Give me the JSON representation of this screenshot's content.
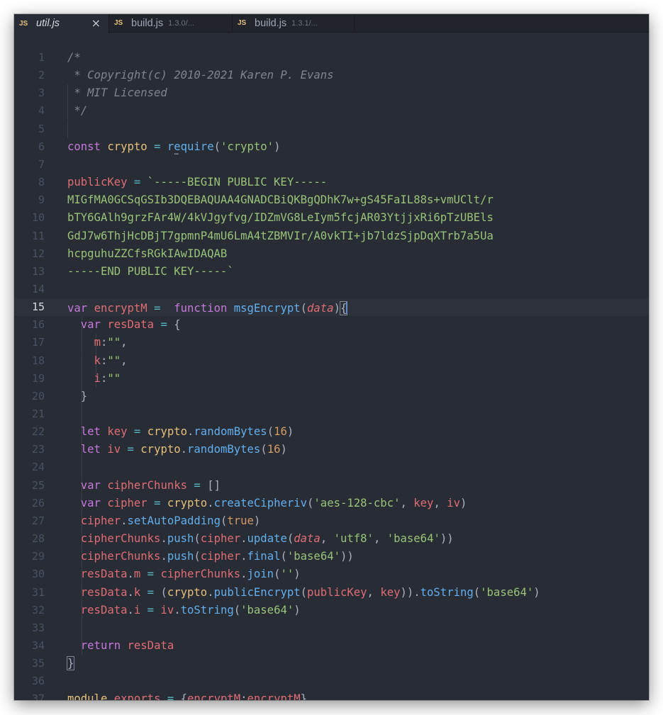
{
  "tabs": [
    {
      "label": "util.js",
      "badge": "JS",
      "path": "",
      "active": true
    },
    {
      "label": "build.js",
      "badge": "JS",
      "path": "1.3.0/...",
      "active": false
    },
    {
      "label": "build.js",
      "badge": "JS",
      "path": "1.3.1/...",
      "active": false
    }
  ],
  "close_icon_glyph": "×",
  "editor": {
    "current_line": 15,
    "line_numbers": [
      "1",
      "2",
      "3",
      "4",
      "5",
      "6",
      "7",
      "8",
      "9",
      "10",
      "11",
      "12",
      "13",
      "14",
      "15",
      "16",
      "17",
      "18",
      "19",
      "20",
      "21",
      "22",
      "23",
      "24",
      "25",
      "26",
      "27",
      "28",
      "29",
      "30",
      "31",
      "32",
      "33",
      "34",
      "35",
      "36",
      "37"
    ],
    "lines": [
      [
        "/*"
      ],
      [
        " * Copyright(c) 2010-2021 Karen P. Evans"
      ],
      [
        " * MIT Licensed"
      ],
      [
        " */"
      ],
      [
        ""
      ],
      [
        "const",
        " ",
        "crypto",
        " ",
        "=",
        " ",
        "require",
        "(",
        "'crypto'",
        ")"
      ],
      [
        ""
      ],
      [
        "publicKey",
        " ",
        "=",
        " ",
        "`-----BEGIN PUBLIC KEY-----"
      ],
      [
        "MIGfMA0GCSqGSIb3DQEBAQUAA4GNADCBiQKBgQDhK7w+gS45FaIL88s+vmUClt/r"
      ],
      [
        "bTY6GAlh9grzFAr4W/4kVJgyfvg/IDZmVG8LeIym5fcjAR03YtjjxRi6pTzUBEls"
      ],
      [
        "GdJ7w6ThjHcDBjT7gpmnP4mU6LmA4tZBMVIr/A0vkTI+jb7ldzSjpDqXTrb7a5Ua"
      ],
      [
        "hcpguhuZZCfsRGkIAwIDAQAB"
      ],
      [
        "-----END PUBLIC KEY-----`"
      ],
      [
        ""
      ],
      [
        "var",
        " ",
        "encryptM",
        " ",
        "=",
        "  ",
        "function",
        " ",
        "msgEncrypt",
        "(",
        "data",
        ")",
        "{"
      ],
      [
        "  ",
        "var",
        " ",
        "resData",
        " ",
        "=",
        " ",
        "{"
      ],
      [
        "    ",
        "m",
        ":",
        "\"\"",
        ","
      ],
      [
        "    ",
        "k",
        ":",
        "\"\"",
        ","
      ],
      [
        "    ",
        "i",
        ":",
        "\"\""
      ],
      [
        "  ",
        "}"
      ],
      [
        ""
      ],
      [
        "  ",
        "let",
        " ",
        "key",
        " ",
        "=",
        " ",
        "crypto",
        ".",
        "randomBytes",
        "(",
        "16",
        ")"
      ],
      [
        "  ",
        "let",
        " ",
        "iv",
        " ",
        "=",
        " ",
        "crypto",
        ".",
        "randomBytes",
        "(",
        "16",
        ")"
      ],
      [
        ""
      ],
      [
        "  ",
        "var",
        " ",
        "cipherChunks",
        " ",
        "=",
        " ",
        "[]"
      ],
      [
        "  ",
        "var",
        " ",
        "cipher",
        " ",
        "=",
        " ",
        "crypto",
        ".",
        "createCipheriv",
        "(",
        "'aes-128-cbc'",
        ", ",
        "key",
        ", ",
        "iv",
        ")"
      ],
      [
        "  ",
        "cipher",
        ".",
        "setAutoPadding",
        "(",
        "true",
        ")"
      ],
      [
        "  ",
        "cipherChunks",
        ".",
        "push",
        "(",
        "cipher",
        ".",
        "update",
        "(",
        "data",
        ", ",
        "'utf8'",
        ", ",
        "'base64'",
        "))"
      ],
      [
        "  ",
        "cipherChunks",
        ".",
        "push",
        "(",
        "cipher",
        ".",
        "final",
        "(",
        "'base64'",
        "))"
      ],
      [
        "  ",
        "resData",
        ".",
        "m",
        " ",
        "=",
        " ",
        "cipherChunks",
        ".",
        "join",
        "(",
        "''",
        ")"
      ],
      [
        "  ",
        "resData",
        ".",
        "k",
        " ",
        "=",
        " ",
        "(",
        "crypto",
        ".",
        "publicEncrypt",
        "(",
        "publicKey",
        ", ",
        "key",
        "))",
        ".",
        "toString",
        "(",
        "'base64'",
        ")"
      ],
      [
        "  ",
        "resData",
        ".",
        "i",
        " ",
        "=",
        " ",
        "iv",
        ".",
        "toString",
        "(",
        "'base64'",
        ")"
      ],
      [
        ""
      ],
      [
        "  ",
        "return",
        " ",
        "resData"
      ],
      [
        "}"
      ],
      [
        ""
      ],
      [
        "module",
        ".",
        "exports",
        " ",
        "=",
        " ",
        "{",
        "encryptM",
        ":",
        "encryptM",
        "}"
      ]
    ]
  },
  "colors": {
    "background": "#282c34",
    "keyword": "#c678dd",
    "variable": "#e06c75",
    "function": "#61afef",
    "string": "#98c379",
    "number": "#d19a66",
    "builtin": "#e5c07b",
    "comment": "#7f848e",
    "cursor": "#528bff"
  }
}
